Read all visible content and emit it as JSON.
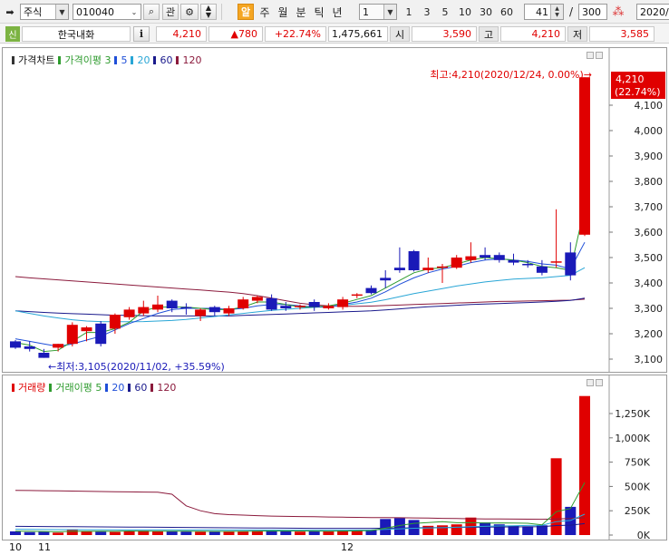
{
  "toolbar": {
    "market": "주식",
    "code": "010040",
    "btn_gwan": "관",
    "btn_al": "알",
    "periods": [
      "주",
      "월",
      "분",
      "틱",
      "년"
    ],
    "interval_value": "1",
    "minute_options": [
      "1",
      "3",
      "5",
      "10",
      "30",
      "60"
    ],
    "count_value": "41",
    "slash": "/",
    "total_value": "300",
    "date_value": "2020/"
  },
  "quote": {
    "badge": "신",
    "stock_name": "한국내화",
    "info_button": "i",
    "price": "4,210",
    "change": "▲780",
    "change_rate": "+22.74%",
    "volume": "1,475,661",
    "open_label": "시",
    "open": "3,590",
    "high_label": "고",
    "high": "4,210",
    "low_label": "저",
    "low": "3,585"
  },
  "price_panel": {
    "legend": [
      {
        "text": "가격차트",
        "color": "#000000"
      },
      {
        "text": "가격이평 3",
        "color": "#2e9b2e"
      },
      {
        "text": "5",
        "color": "#1f4fd8"
      },
      {
        "text": "20",
        "color": "#29a6d6"
      },
      {
        "text": "60",
        "color": "#1a1a8c"
      },
      {
        "text": "120",
        "color": "#8b1a3c"
      }
    ],
    "y_ticks": [
      "4,100",
      "4,000",
      "3,900",
      "3,800",
      "3,700",
      "3,600",
      "3,500",
      "3,400",
      "3,300",
      "3,200",
      "3,100"
    ],
    "last_price_tag": "4,210",
    "last_change_tag": "(22.74%)",
    "high_note": "최고:4,210(2020/12/24, 0.00%)→",
    "low_note": "←최저:3,105(2020/11/02, +35.59%)"
  },
  "volume_panel": {
    "legend": [
      {
        "text": "거래량",
        "color": "#000000"
      },
      {
        "text": "거래이평 5",
        "color": "#2e9b2e"
      },
      {
        "text": "20",
        "color": "#1f4fd8"
      },
      {
        "text": "60",
        "color": "#1a1a8c"
      },
      {
        "text": "120",
        "color": "#8b1a3c"
      }
    ],
    "y_ticks": [
      "1,250K",
      "1,000K",
      "750K",
      "500K",
      "250K",
      "0K"
    ],
    "x_labels": [
      "10",
      "11",
      "12"
    ]
  },
  "colors": {
    "up": "#e00000",
    "down": "#1a1ab8",
    "ma3": "#2e9b2e",
    "ma5": "#1f4fd8",
    "ma20": "#29a6d6",
    "ma60": "#1a1a8c",
    "ma120": "#8b1a3c"
  },
  "chart_data": {
    "type": "candlestick",
    "ylim": [
      3050,
      4210
    ],
    "candles": [
      {
        "o": 3170,
        "h": 3175,
        "l": 3140,
        "c": 3145
      },
      {
        "o": 3150,
        "h": 3170,
        "l": 3130,
        "c": 3140
      },
      {
        "o": 3125,
        "h": 3140,
        "l": 3105,
        "c": 3105
      },
      {
        "o": 3145,
        "h": 3160,
        "l": 3130,
        "c": 3160
      },
      {
        "o": 3160,
        "h": 3245,
        "l": 3150,
        "c": 3235
      },
      {
        "o": 3210,
        "h": 3230,
        "l": 3170,
        "c": 3225
      },
      {
        "o": 3240,
        "h": 3250,
        "l": 3150,
        "c": 3160
      },
      {
        "o": 3220,
        "h": 3280,
        "l": 3200,
        "c": 3275
      },
      {
        "o": 3265,
        "h": 3305,
        "l": 3255,
        "c": 3295
      },
      {
        "o": 3280,
        "h": 3330,
        "l": 3270,
        "c": 3305
      },
      {
        "o": 3295,
        "h": 3350,
        "l": 3285,
        "c": 3315
      },
      {
        "o": 3330,
        "h": 3335,
        "l": 3285,
        "c": 3300
      },
      {
        "o": 3305,
        "h": 3320,
        "l": 3275,
        "c": 3300
      },
      {
        "o": 3270,
        "h": 3300,
        "l": 3250,
        "c": 3295
      },
      {
        "o": 3305,
        "h": 3310,
        "l": 3270,
        "c": 3285
      },
      {
        "o": 3280,
        "h": 3310,
        "l": 3270,
        "c": 3300
      },
      {
        "o": 3300,
        "h": 3345,
        "l": 3295,
        "c": 3335
      },
      {
        "o": 3330,
        "h": 3350,
        "l": 3320,
        "c": 3345
      },
      {
        "o": 3340,
        "h": 3355,
        "l": 3290,
        "c": 3295
      },
      {
        "o": 3310,
        "h": 3325,
        "l": 3290,
        "c": 3300
      },
      {
        "o": 3305,
        "h": 3315,
        "l": 3295,
        "c": 3310
      },
      {
        "o": 3325,
        "h": 3335,
        "l": 3290,
        "c": 3305
      },
      {
        "o": 3300,
        "h": 3320,
        "l": 3295,
        "c": 3310
      },
      {
        "o": 3305,
        "h": 3345,
        "l": 3295,
        "c": 3335
      },
      {
        "o": 3350,
        "h": 3360,
        "l": 3340,
        "c": 3355
      },
      {
        "o": 3380,
        "h": 3390,
        "l": 3355,
        "c": 3360
      },
      {
        "o": 3420,
        "h": 3450,
        "l": 3380,
        "c": 3410
      },
      {
        "o": 3460,
        "h": 3540,
        "l": 3440,
        "c": 3450
      },
      {
        "o": 3525,
        "h": 3530,
        "l": 3445,
        "c": 3450
      },
      {
        "o": 3450,
        "h": 3500,
        "l": 3440,
        "c": 3460
      },
      {
        "o": 3460,
        "h": 3475,
        "l": 3400,
        "c": 3465
      },
      {
        "o": 3460,
        "h": 3510,
        "l": 3455,
        "c": 3500
      },
      {
        "o": 3490,
        "h": 3560,
        "l": 3480,
        "c": 3505
      },
      {
        "o": 3510,
        "h": 3540,
        "l": 3490,
        "c": 3500
      },
      {
        "o": 3510,
        "h": 3520,
        "l": 3480,
        "c": 3490
      },
      {
        "o": 3490,
        "h": 3515,
        "l": 3470,
        "c": 3480
      },
      {
        "o": 3475,
        "h": 3490,
        "l": 3460,
        "c": 3470
      },
      {
        "o": 3465,
        "h": 3490,
        "l": 3430,
        "c": 3440
      },
      {
        "o": 3480,
        "h": 3690,
        "l": 3460,
        "c": 3485
      },
      {
        "o": 3520,
        "h": 3560,
        "l": 3410,
        "c": 3430
      },
      {
        "o": 3590,
        "h": 4210,
        "l": 3585,
        "c": 4210
      }
    ],
    "volumes_k": [
      38,
      30,
      35,
      25,
      60,
      40,
      35,
      32,
      42,
      45,
      40,
      38,
      36,
      34,
      36,
      40,
      42,
      44,
      48,
      40,
      35,
      38,
      42,
      48,
      50,
      52,
      165,
      175,
      155,
      95,
      100,
      110,
      180,
      130,
      110,
      95,
      90,
      100,
      790,
      290,
      1430
    ],
    "ma": {
      "ma3": [
        3165,
        3155,
        3130,
        3135,
        3170,
        3205,
        3205,
        3220,
        3245,
        3290,
        3305,
        3305,
        3305,
        3300,
        3295,
        3295,
        3305,
        3325,
        3325,
        3315,
        3305,
        3305,
        3310,
        3320,
        3335,
        3350,
        3380,
        3410,
        3440,
        3455,
        3460,
        3475,
        3490,
        3500,
        3495,
        3490,
        3480,
        3465,
        3460,
        3450,
        3700
      ],
      "ma5": [
        3180,
        3170,
        3160,
        3150,
        3160,
        3175,
        3190,
        3215,
        3240,
        3260,
        3280,
        3295,
        3300,
        3300,
        3300,
        3295,
        3300,
        3310,
        3315,
        3315,
        3310,
        3305,
        3305,
        3315,
        3325,
        3340,
        3365,
        3395,
        3420,
        3440,
        3455,
        3465,
        3480,
        3490,
        3495,
        3490,
        3485,
        3475,
        3470,
        3455,
        3560
      ],
      "ma20": [
        3290,
        3280,
        3270,
        3262,
        3255,
        3250,
        3248,
        3247,
        3247,
        3248,
        3250,
        3252,
        3256,
        3262,
        3268,
        3274,
        3280,
        3286,
        3292,
        3296,
        3300,
        3304,
        3308,
        3312,
        3318,
        3324,
        3334,
        3346,
        3358,
        3368,
        3378,
        3388,
        3396,
        3404,
        3410,
        3415,
        3418,
        3420,
        3425,
        3430,
        3460
      ],
      "ma60": [
        3290,
        3287,
        3284,
        3281,
        3279,
        3277,
        3275,
        3273,
        3272,
        3271,
        3270,
        3270,
        3270,
        3270,
        3270,
        3270,
        3272,
        3274,
        3276,
        3278,
        3280,
        3282,
        3284,
        3286,
        3288,
        3290,
        3294,
        3298,
        3302,
        3306,
        3309,
        3312,
        3315,
        3317,
        3319,
        3321,
        3323,
        3325,
        3328,
        3331,
        3340
      ],
      "ma120": [
        3425,
        3420,
        3416,
        3412,
        3408,
        3404,
        3400,
        3396,
        3392,
        3388,
        3384,
        3380,
        3376,
        3372,
        3368,
        3364,
        3358,
        3350,
        3340,
        3330,
        3320,
        3314,
        3310,
        3308,
        3308,
        3309,
        3311,
        3313,
        3315,
        3317,
        3319,
        3321,
        3323,
        3325,
        3327,
        3328,
        3329,
        3330,
        3331,
        3332,
        3336
      ]
    },
    "vol_ma": {
      "ma5": [
        40,
        38,
        36,
        34,
        38,
        38,
        40,
        38,
        42,
        39,
        39,
        39,
        40,
        38,
        37,
        37,
        38,
        39,
        42,
        42,
        42,
        41,
        40,
        41,
        43,
        46,
        71,
        98,
        120,
        129,
        138,
        127,
        128,
        123,
        125,
        123,
        121,
        105,
        240,
        273,
        540
      ],
      "ma20": [
        60,
        58,
        57,
        56,
        56,
        55,
        55,
        54,
        54,
        54,
        53,
        53,
        52,
        52,
        52,
        51,
        51,
        51,
        51,
        50,
        50,
        50,
        50,
        50,
        51,
        52,
        58,
        64,
        70,
        73,
        76,
        80,
        86,
        90,
        93,
        96,
        99,
        101,
        138,
        150,
        215
      ],
      "ma60": [
        90,
        89,
        88,
        87,
        86,
        85,
        84,
        83,
        82,
        81,
        80,
        79,
        78,
        77,
        76,
        75,
        74,
        73,
        72,
        71,
        70,
        69,
        69,
        69,
        69,
        69,
        71,
        73,
        75,
        76,
        77,
        78,
        80,
        82,
        83,
        84,
        85,
        86,
        98,
        102,
        118
      ],
      "ma120": [
        460,
        458,
        456,
        454,
        452,
        450,
        448,
        446,
        444,
        442,
        440,
        420,
        300,
        250,
        220,
        210,
        205,
        200,
        195,
        192,
        190,
        188,
        186,
        184,
        182,
        180,
        180,
        178,
        176,
        174,
        172,
        170,
        168,
        166,
        165,
        164,
        163,
        162,
        166,
        170,
        178
      ]
    }
  }
}
